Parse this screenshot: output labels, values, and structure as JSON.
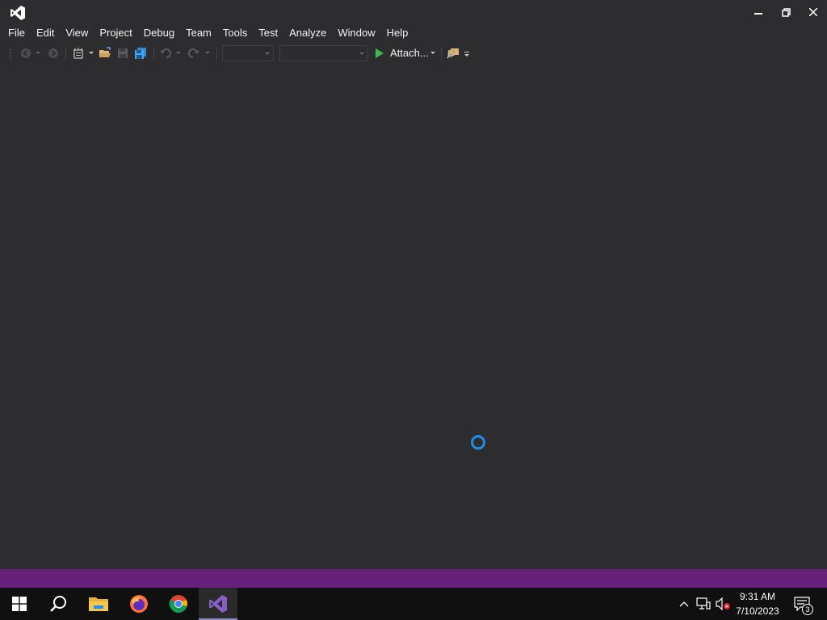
{
  "menu": {
    "items": [
      "File",
      "Edit",
      "View",
      "Project",
      "Debug",
      "Team",
      "Tools",
      "Test",
      "Analyze",
      "Window",
      "Help"
    ]
  },
  "toolbar": {
    "attach_label": "Attach...",
    "solution_config_value": "",
    "solution_platform_value": ""
  },
  "colors": {
    "background": "#2d2d30",
    "status_bar": "#68217a",
    "taskbar": "#101010",
    "accent": "#1e8ee8"
  },
  "taskbar": {
    "clock_time": "9:31 AM",
    "clock_date": "7/10/2023",
    "notification_count": "3",
    "apps": [
      "start-icon",
      "search-icon",
      "file-explorer-icon",
      "firefox-icon",
      "chrome-icon",
      "visual-studio-icon"
    ]
  }
}
